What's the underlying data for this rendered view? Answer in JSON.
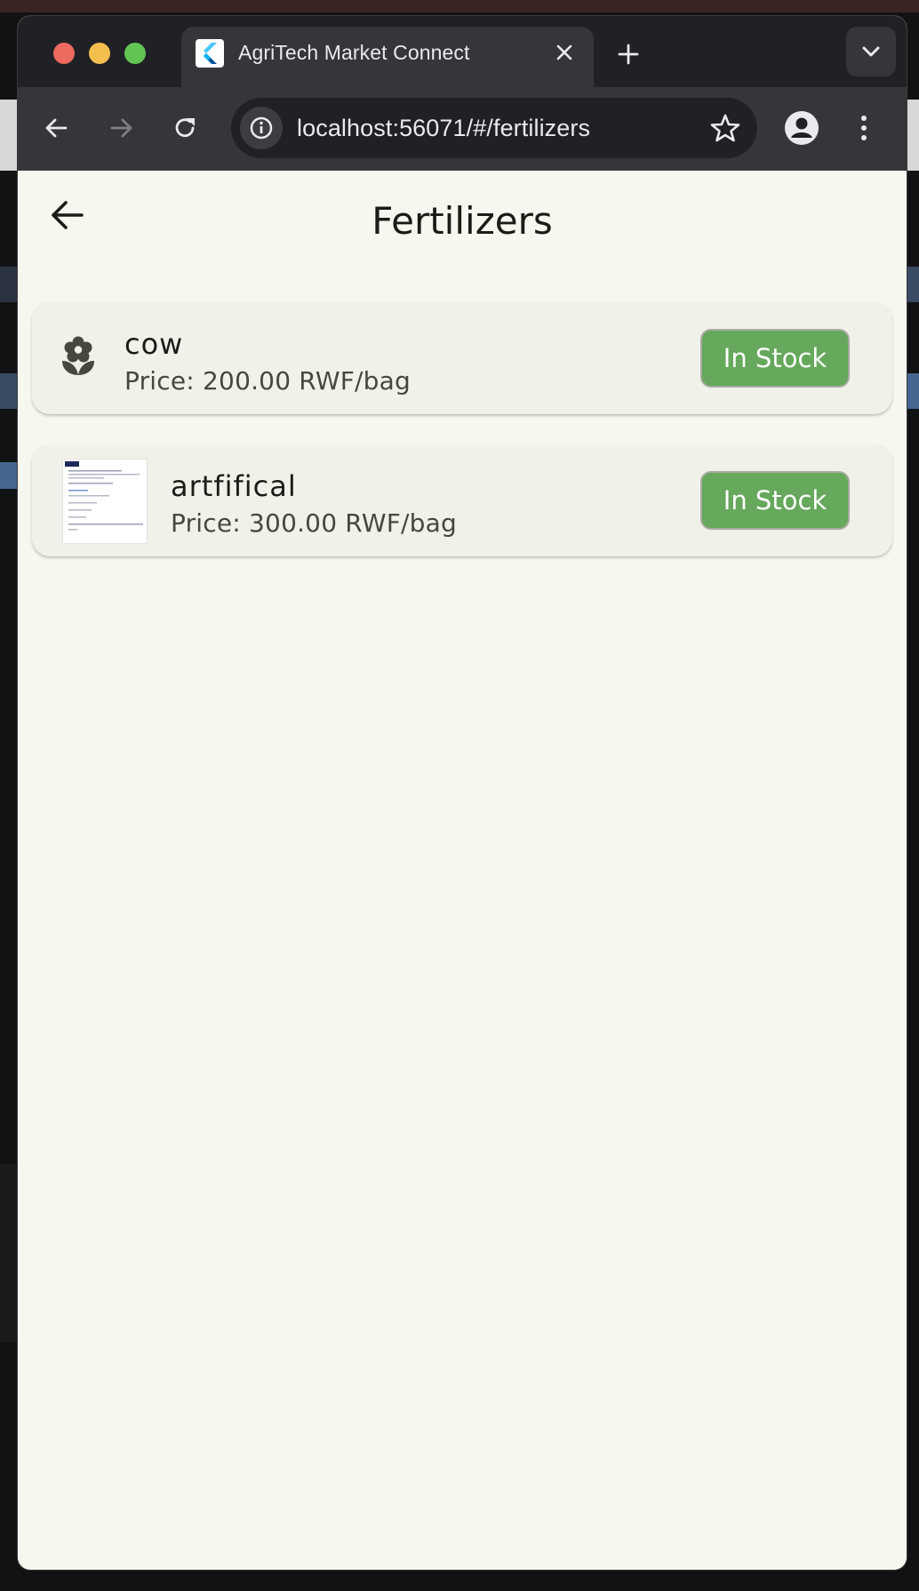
{
  "browser": {
    "tab_title": "AgriTech Market Connect",
    "url": "localhost:56071/#/fertilizers"
  },
  "page": {
    "title": "Fertilizers"
  },
  "fertilizers": [
    {
      "name": "cow",
      "price": "Price: 200.00 RWF/bag",
      "status": "In Stock",
      "image": "flower-icon"
    },
    {
      "name": "artfifical",
      "price": "Price: 300.00 RWF/bag",
      "status": "In Stock",
      "image": "document-thumbnail"
    }
  ],
  "colors": {
    "accent_green": "#66a85c",
    "page_background": "#f6f8ef",
    "card_background": "#f0f1e8"
  }
}
